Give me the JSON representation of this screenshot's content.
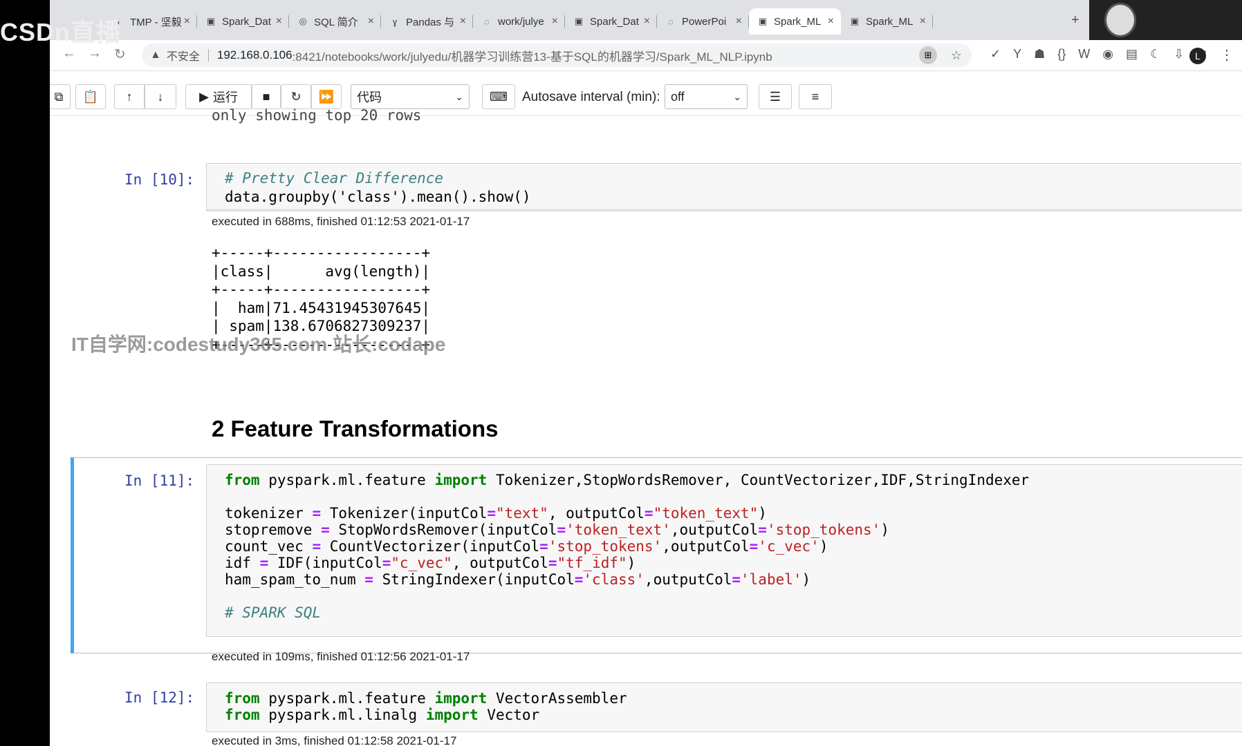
{
  "logo": "CSDn直播",
  "watermark": "IT自学网:codestudy365.com 站长:codape",
  "browser": {
    "tabs": [
      {
        "label": "TMP - 坚毅",
        "icon": "tab-icon-tmp"
      },
      {
        "label": "Spark_Dat",
        "icon": "tab-icon-notebook"
      },
      {
        "label": "SQL 简介",
        "icon": "tab-icon-sql"
      },
      {
        "label": "Pandas 与",
        "icon": "tab-icon-pandas"
      },
      {
        "label": "work/julye",
        "icon": "tab-icon-loading"
      },
      {
        "label": "Spark_Dat",
        "icon": "tab-icon-notebook"
      },
      {
        "label": "PowerPoi",
        "icon": "tab-icon-loading"
      },
      {
        "label": "Spark_ML",
        "icon": "tab-icon-notebook",
        "active": true
      },
      {
        "label": "Spark_ML",
        "icon": "tab-icon-notebook"
      }
    ],
    "security_label": "不安全",
    "url_host": "192.168.0.106",
    "url_path": ":8421/notebooks/work/julyedu/机器学习训练营13-基于SQL的机器学习/Spark_ML_NLP.ipynb",
    "profile_letter": "L"
  },
  "toolbar": {
    "run_label": "运行",
    "cell_type": "代码",
    "autosave_label": "Autosave interval (min):",
    "autosave_value": "off"
  },
  "notebook": {
    "prev_output_tail": "only showing top 20 rows",
    "cell10": {
      "prompt": "In [10]:",
      "line1": "# Pretty Clear Difference",
      "line2": "data.groupby('class').mean().show()",
      "exec": "executed in 688ms, finished 01:12:53 2021-01-17",
      "output": "+-----+-----------------+\n|class|      avg(length)|\n+-----+-----------------+\n|  ham|71.45431945307645|\n| spam|138.6706827309237|\n+-----+-----------------+"
    },
    "heading": "2  Feature Transformations",
    "cell11": {
      "prompt": "In [11]:",
      "lines": [
        "from pyspark.ml.feature import Tokenizer,StopWordsRemover, CountVectorizer,IDF,StringIndexer",
        "",
        "tokenizer = Tokenizer(inputCol=\"text\", outputCol=\"token_text\")",
        "stopremove = StopWordsRemover(inputCol='token_text',outputCol='stop_tokens')",
        "count_vec = CountVectorizer(inputCol='stop_tokens',outputCol='c_vec')",
        "idf = IDF(inputCol=\"c_vec\", outputCol=\"tf_idf\")",
        "ham_spam_to_num = StringIndexer(inputCol='class',outputCol='label')",
        "",
        "# SPARK SQL"
      ],
      "exec": "executed in 109ms, finished 01:12:56 2021-01-17"
    },
    "cell12": {
      "prompt": "In [12]:",
      "lines": [
        "from pyspark.ml.feature import VectorAssembler",
        "from pyspark.ml.linalg import Vector"
      ],
      "exec": "executed in 3ms, finished 01:12:58 2021-01-17"
    }
  }
}
